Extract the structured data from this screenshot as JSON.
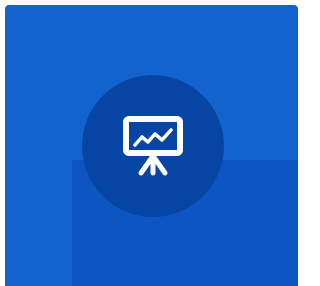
{
  "tile": {
    "icon": "presentation-chart-icon",
    "colors": {
      "tile_background": "#1363cf",
      "tile_shade": "#0c55c3",
      "icon_circle": "#0645a3",
      "icon_stroke": "#ffffff"
    }
  }
}
